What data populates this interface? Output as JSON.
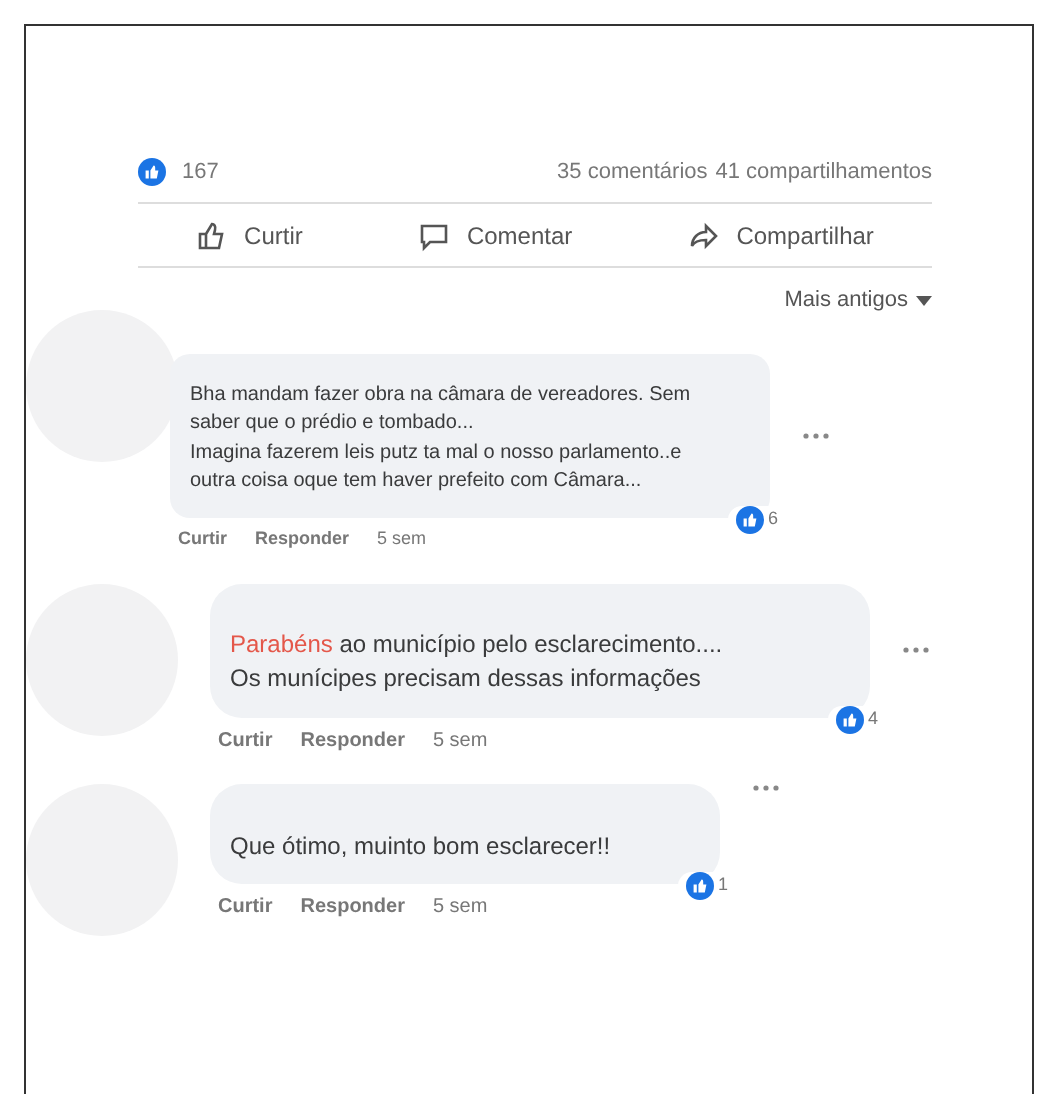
{
  "summary": {
    "reactions": "167",
    "comments": "35 comentários",
    "shares": "41 compartilhamentos"
  },
  "actions": [
    {
      "label": "Curtir",
      "kind": "like"
    },
    {
      "label": "Comentar",
      "kind": "comment"
    },
    {
      "label": "Compartilhar",
      "kind": "share"
    }
  ],
  "sort": {
    "label": "Mais antigos"
  },
  "comments": [
    {
      "text": "Bha mandam fazer obra na câmara de vereadores. Sem saber que o prédio e tombado...\nImagina fazerem leis putz ta mal o nosso parlamento..e outra coisa oque tem haver prefeito com Câmara...",
      "reactions": "6",
      "like": "Curtir",
      "reply": "Responder",
      "time": "5 sem"
    },
    {
      "highlight": "Parabéns",
      "text": " ao município pelo esclarecimento....\nOs munícipes precisam dessas informações",
      "reactions": "4",
      "like": "Curtir",
      "reply": "Responder",
      "time": "5 sem"
    },
    {
      "text": "Que ótimo, muinto bom esclarecer!!",
      "reactions": "1",
      "like": "Curtir",
      "reply": "Responder",
      "time": "5 sem"
    }
  ]
}
